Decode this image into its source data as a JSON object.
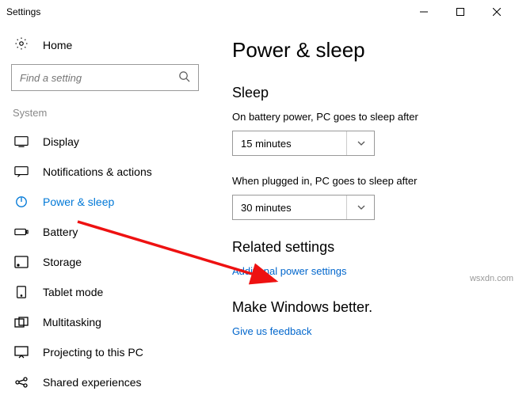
{
  "window": {
    "title": "Settings"
  },
  "home": {
    "label": "Home"
  },
  "search": {
    "placeholder": "Find a setting"
  },
  "group_label": "System",
  "nav": {
    "display": "Display",
    "notifications": "Notifications & actions",
    "power": "Power & sleep",
    "battery": "Battery",
    "storage": "Storage",
    "tablet": "Tablet mode",
    "multitasking": "Multitasking",
    "projecting": "Projecting to this PC",
    "shared": "Shared experiences"
  },
  "page": {
    "title": "Power & sleep",
    "sleep_heading": "Sleep",
    "battery_label": "On battery power, PC goes to sleep after",
    "battery_value": "15 minutes",
    "plugged_label": "When plugged in, PC goes to sleep after",
    "plugged_value": "30 minutes",
    "related_heading": "Related settings",
    "related_link": "Additional power settings",
    "better_heading": "Make Windows better.",
    "feedback_link": "Give us feedback"
  },
  "watermark": "wsxdn.com"
}
